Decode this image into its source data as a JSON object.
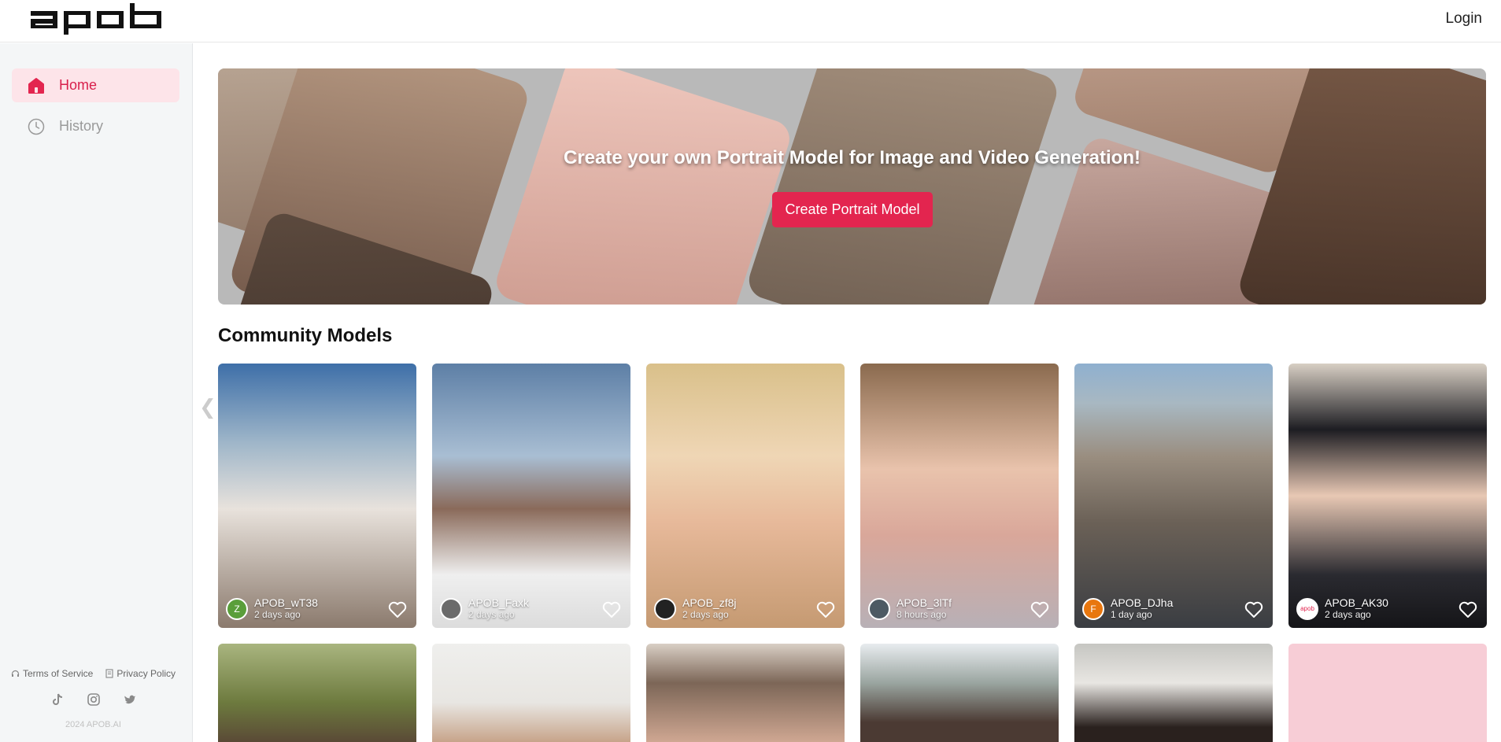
{
  "header": {
    "logo_text": "apob",
    "login_label": "Login"
  },
  "sidebar": {
    "items": [
      {
        "label": "Home",
        "icon": "home-icon",
        "active": true
      },
      {
        "label": "History",
        "icon": "clock-icon",
        "active": false
      }
    ],
    "footer": {
      "terms_label": "Terms of Service",
      "privacy_label": "Privacy Policy",
      "socials": [
        "tiktok-icon",
        "instagram-icon",
        "twitter-icon"
      ],
      "copyright": "2024 APOB.AI"
    }
  },
  "banner": {
    "title": "Create your own Portrait Model for Image and Video Generation!",
    "button_label": "Create Portrait Model"
  },
  "community": {
    "title": "Community Models",
    "models": [
      {
        "name": "APOB_wT38",
        "time": "2 days ago",
        "avatar_letter": "Z",
        "avatar_color": "#5a9e3a"
      },
      {
        "name": "APOB_Faxk",
        "time": "2 days ago",
        "avatar_letter": "",
        "avatar_color": "#6b6b6b"
      },
      {
        "name": "APOB_zf8j",
        "time": "2 days ago",
        "avatar_letter": "",
        "avatar_color": "#222222"
      },
      {
        "name": "APOB_3lTf",
        "time": "8 hours ago",
        "avatar_letter": "",
        "avatar_color": "#4d5a63"
      },
      {
        "name": "APOB_DJha",
        "time": "1 day ago",
        "avatar_letter": "F",
        "avatar_color": "#e8770f"
      },
      {
        "name": "APOB_AK30",
        "time": "2 days ago",
        "avatar_letter": "apob",
        "avatar_color": "#ffffff"
      }
    ]
  },
  "colors": {
    "accent": "#e3254f",
    "active_nav_bg": "#fde4e9"
  }
}
